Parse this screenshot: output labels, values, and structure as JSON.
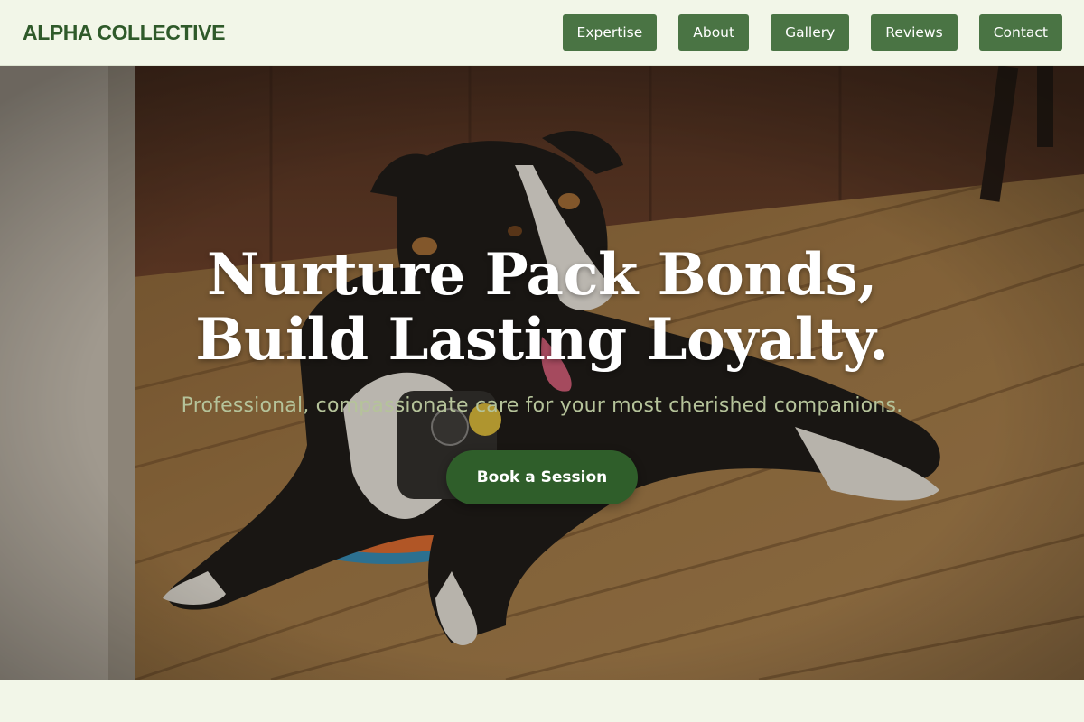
{
  "brand": {
    "name": "ALPHA COLLECTIVE"
  },
  "nav": {
    "items": [
      {
        "label": "Expertise"
      },
      {
        "label": "About"
      },
      {
        "label": "Gallery"
      },
      {
        "label": "Reviews"
      },
      {
        "label": "Contact"
      }
    ]
  },
  "hero": {
    "title_line1": "Nurture Pack Bonds,",
    "title_line2": "Build Lasting Loyalty.",
    "subtitle": "Professional, compassionate care for your most cherished companions.",
    "cta_label": "Book a Session",
    "image_subject": "dog-lying-on-wooden-deck-photo"
  },
  "colors": {
    "accent": "#4a7444",
    "cta": "#2f5e2a",
    "brand_text": "#2f5a2a",
    "page_bg": "#f2f6e8",
    "subtitle": "#b5c39a"
  }
}
